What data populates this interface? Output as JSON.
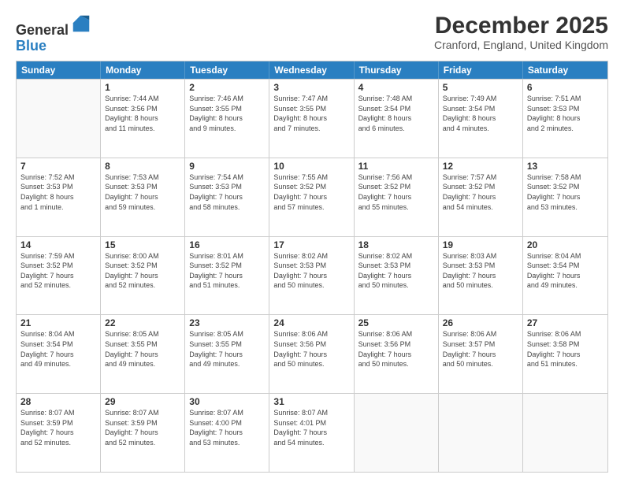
{
  "header": {
    "logo_line1": "General",
    "logo_line2": "Blue",
    "month_title": "December 2025",
    "location": "Cranford, England, United Kingdom"
  },
  "days_of_week": [
    "Sunday",
    "Monday",
    "Tuesday",
    "Wednesday",
    "Thursday",
    "Friday",
    "Saturday"
  ],
  "weeks": [
    [
      {
        "day": "",
        "info": ""
      },
      {
        "day": "1",
        "info": "Sunrise: 7:44 AM\nSunset: 3:56 PM\nDaylight: 8 hours\nand 11 minutes."
      },
      {
        "day": "2",
        "info": "Sunrise: 7:46 AM\nSunset: 3:55 PM\nDaylight: 8 hours\nand 9 minutes."
      },
      {
        "day": "3",
        "info": "Sunrise: 7:47 AM\nSunset: 3:55 PM\nDaylight: 8 hours\nand 7 minutes."
      },
      {
        "day": "4",
        "info": "Sunrise: 7:48 AM\nSunset: 3:54 PM\nDaylight: 8 hours\nand 6 minutes."
      },
      {
        "day": "5",
        "info": "Sunrise: 7:49 AM\nSunset: 3:54 PM\nDaylight: 8 hours\nand 4 minutes."
      },
      {
        "day": "6",
        "info": "Sunrise: 7:51 AM\nSunset: 3:53 PM\nDaylight: 8 hours\nand 2 minutes."
      }
    ],
    [
      {
        "day": "7",
        "info": "Sunrise: 7:52 AM\nSunset: 3:53 PM\nDaylight: 8 hours\nand 1 minute."
      },
      {
        "day": "8",
        "info": "Sunrise: 7:53 AM\nSunset: 3:53 PM\nDaylight: 7 hours\nand 59 minutes."
      },
      {
        "day": "9",
        "info": "Sunrise: 7:54 AM\nSunset: 3:53 PM\nDaylight: 7 hours\nand 58 minutes."
      },
      {
        "day": "10",
        "info": "Sunrise: 7:55 AM\nSunset: 3:52 PM\nDaylight: 7 hours\nand 57 minutes."
      },
      {
        "day": "11",
        "info": "Sunrise: 7:56 AM\nSunset: 3:52 PM\nDaylight: 7 hours\nand 55 minutes."
      },
      {
        "day": "12",
        "info": "Sunrise: 7:57 AM\nSunset: 3:52 PM\nDaylight: 7 hours\nand 54 minutes."
      },
      {
        "day": "13",
        "info": "Sunrise: 7:58 AM\nSunset: 3:52 PM\nDaylight: 7 hours\nand 53 minutes."
      }
    ],
    [
      {
        "day": "14",
        "info": "Sunrise: 7:59 AM\nSunset: 3:52 PM\nDaylight: 7 hours\nand 52 minutes."
      },
      {
        "day": "15",
        "info": "Sunrise: 8:00 AM\nSunset: 3:52 PM\nDaylight: 7 hours\nand 52 minutes."
      },
      {
        "day": "16",
        "info": "Sunrise: 8:01 AM\nSunset: 3:52 PM\nDaylight: 7 hours\nand 51 minutes."
      },
      {
        "day": "17",
        "info": "Sunrise: 8:02 AM\nSunset: 3:53 PM\nDaylight: 7 hours\nand 50 minutes."
      },
      {
        "day": "18",
        "info": "Sunrise: 8:02 AM\nSunset: 3:53 PM\nDaylight: 7 hours\nand 50 minutes."
      },
      {
        "day": "19",
        "info": "Sunrise: 8:03 AM\nSunset: 3:53 PM\nDaylight: 7 hours\nand 50 minutes."
      },
      {
        "day": "20",
        "info": "Sunrise: 8:04 AM\nSunset: 3:54 PM\nDaylight: 7 hours\nand 49 minutes."
      }
    ],
    [
      {
        "day": "21",
        "info": "Sunrise: 8:04 AM\nSunset: 3:54 PM\nDaylight: 7 hours\nand 49 minutes."
      },
      {
        "day": "22",
        "info": "Sunrise: 8:05 AM\nSunset: 3:55 PM\nDaylight: 7 hours\nand 49 minutes."
      },
      {
        "day": "23",
        "info": "Sunrise: 8:05 AM\nSunset: 3:55 PM\nDaylight: 7 hours\nand 49 minutes."
      },
      {
        "day": "24",
        "info": "Sunrise: 8:06 AM\nSunset: 3:56 PM\nDaylight: 7 hours\nand 50 minutes."
      },
      {
        "day": "25",
        "info": "Sunrise: 8:06 AM\nSunset: 3:56 PM\nDaylight: 7 hours\nand 50 minutes."
      },
      {
        "day": "26",
        "info": "Sunrise: 8:06 AM\nSunset: 3:57 PM\nDaylight: 7 hours\nand 50 minutes."
      },
      {
        "day": "27",
        "info": "Sunrise: 8:06 AM\nSunset: 3:58 PM\nDaylight: 7 hours\nand 51 minutes."
      }
    ],
    [
      {
        "day": "28",
        "info": "Sunrise: 8:07 AM\nSunset: 3:59 PM\nDaylight: 7 hours\nand 52 minutes."
      },
      {
        "day": "29",
        "info": "Sunrise: 8:07 AM\nSunset: 3:59 PM\nDaylight: 7 hours\nand 52 minutes."
      },
      {
        "day": "30",
        "info": "Sunrise: 8:07 AM\nSunset: 4:00 PM\nDaylight: 7 hours\nand 53 minutes."
      },
      {
        "day": "31",
        "info": "Sunrise: 8:07 AM\nSunset: 4:01 PM\nDaylight: 7 hours\nand 54 minutes."
      },
      {
        "day": "",
        "info": ""
      },
      {
        "day": "",
        "info": ""
      },
      {
        "day": "",
        "info": ""
      }
    ]
  ]
}
